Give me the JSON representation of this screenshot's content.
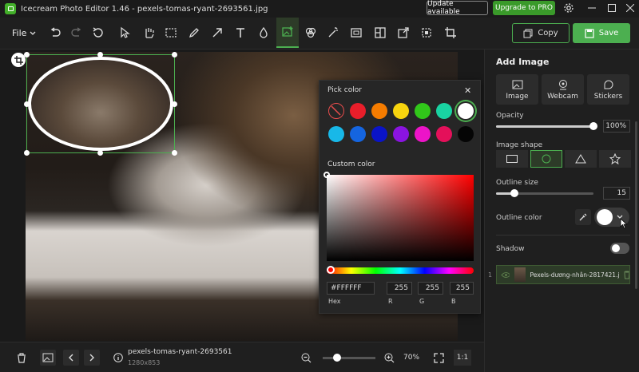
{
  "window": {
    "title": "Icecream Photo Editor 1.46 - pexels-tomas-ryant-2693561.jpg",
    "update_label": "Update available",
    "upgrade_label": "Upgrade to PRO"
  },
  "toolbar": {
    "file_label": "File",
    "copy_label": "Copy",
    "save_label": "Save"
  },
  "color_picker": {
    "title": "Pick color",
    "custom_title": "Custom color",
    "preset_colors": [
      "none",
      "#e91e2a",
      "#f57c00",
      "#f7d40e",
      "#31c71a",
      "#19d3a2",
      "#ffffff",
      "#18b8e8",
      "#1565e0",
      "#0a14c8",
      "#8a14e0",
      "#ec14c8",
      "#e4105a",
      "#050505"
    ],
    "selected_color": "#ffffff",
    "hex_value": "#FFFFFF",
    "r_value": "255",
    "g_value": "255",
    "b_value": "255",
    "hex_label": "Hex",
    "r_label": "R",
    "g_label": "G",
    "b_label": "B"
  },
  "panel": {
    "title": "Add Image",
    "btn_image": "Image",
    "btn_webcam": "Webcam",
    "btn_stickers": "Stickers",
    "opacity_label": "Opacity",
    "opacity_value": "100%",
    "shape_label": "Image shape",
    "selected_shape": "circle",
    "outline_size_label": "Outline size",
    "outline_size_value": "15",
    "outline_color_label": "Outline color",
    "outline_color": "#ffffff",
    "shadow_label": "Shadow",
    "layer_number": "1",
    "layer_name": "Pexels-dương-nhân-2817421.j"
  },
  "bottombar": {
    "file_name": "pexels-tomas-ryant-2693561",
    "dimensions": "1280x853",
    "zoom_value": "70%",
    "ratio_label": "1:1"
  }
}
